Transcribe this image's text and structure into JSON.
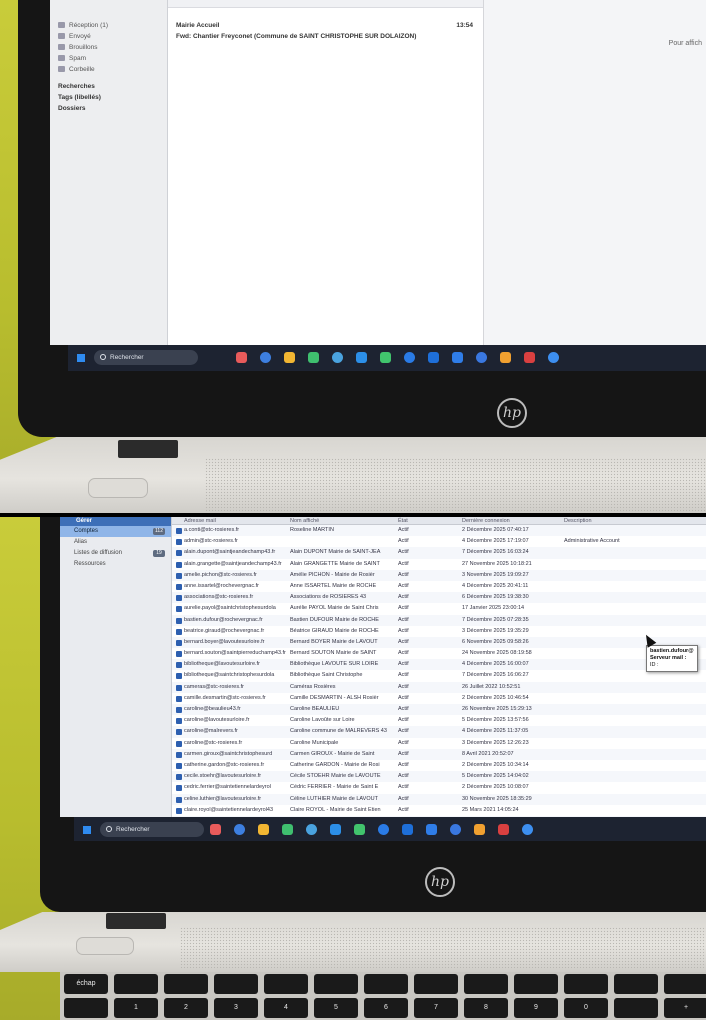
{
  "mail": {
    "folders": [
      {
        "label": "Réception (1)",
        "bold": false
      },
      {
        "label": "Envoyé",
        "bold": false
      },
      {
        "label": "Brouillons",
        "bold": false
      },
      {
        "label": "Spam",
        "bold": false
      },
      {
        "label": "Corbeille",
        "bold": false
      },
      {
        "label": "Recherches",
        "bold": true
      },
      {
        "label": "Tags (libellés)",
        "bold": true
      },
      {
        "label": "Dossiers",
        "bold": true
      }
    ],
    "messages": [
      {
        "text": "Mairie Accueil",
        "time": "13:54"
      },
      {
        "text": "Fwd: Chantier Freyconet (Commune de SAINT CHRISTOPHE SUR DOLAIZON)",
        "time": ""
      }
    ],
    "preview_hint": "Pour affich"
  },
  "taskbar": {
    "search_label": "Rechercher",
    "icon_colors": [
      "#e85b5b",
      "#3d7fe0",
      "#f2b632",
      "#3fbf6f",
      "#4aa3df",
      "#2c8fe8",
      "#41c46d",
      "#2a7be6",
      "#1e6fd9",
      "#2f7de8",
      "#3a78e0",
      "#f0a030",
      "#d94040",
      "#3d8ff0"
    ]
  },
  "admin": {
    "sidebar_header": "Gérer",
    "sidebar": [
      {
        "label": "Comptes",
        "count": "112",
        "selected": true
      },
      {
        "label": "Alias",
        "count": "",
        "selected": false
      },
      {
        "label": "Listes de diffusion",
        "count": "19",
        "selected": false
      },
      {
        "label": "Ressources",
        "count": "",
        "selected": false
      }
    ],
    "columns": [
      "Adresse mail",
      "Nom affiché",
      "État",
      "Dernière connexion",
      "Description"
    ],
    "rows": [
      [
        "a.conti@stc-rosieres.fr",
        "Roseline MARTIN",
        "Actif",
        "2 Décembre 2025 07:40:17",
        ""
      ],
      [
        "admin@stc-rosieres.fr",
        "",
        "Actif",
        "4 Décembre 2025 17:19:07",
        "Administrative Account"
      ],
      [
        "alain.dupont@saintjeandechamp43.fr",
        "Alain DUPONT Mairie de SAINT-JEA",
        "Actif",
        "7 Décembre 2025 16:03:24",
        ""
      ],
      [
        "alain.grangette@saintjeandechamp43.fr",
        "Alain GRANGETTE Mairie de SAINT",
        "Actif",
        "27 Novembre 2025 10:18:21",
        ""
      ],
      [
        "amelie.pichon@stc-rosieres.fr",
        "Amélie PICHON - Mairie de Rosièr",
        "Actif",
        "3 Novembre 2025 19:09:27",
        ""
      ],
      [
        "anne.issartel@rochevergnac.fr",
        "Anne ISSARTEL Mairie de ROCHE",
        "Actif",
        "4 Décembre 2025 20:41:11",
        ""
      ],
      [
        "associations@stc-rosieres.fr",
        "Associations de ROSIERES 43",
        "Actif",
        "6 Décembre 2025 19:38:30",
        ""
      ],
      [
        "aurelie.payol@saintchristophesurdola",
        "Aurélie PAYOL Mairie de Saint Chris",
        "Actif",
        "17 Janvier 2025 23:00:14",
        ""
      ],
      [
        "bastien.dufour@rochevergnac.fr",
        "Bastien DUFOUR Mairie de ROCHE",
        "Actif",
        "7 Décembre 2025 07:28:35",
        ""
      ],
      [
        "beatrice.giraud@rochevergnac.fr",
        "Béatrice GIRAUD Mairie de ROCHE",
        "Actif",
        "3 Décembre 2025 19:35:29",
        ""
      ],
      [
        "bernard.boyer@lavoutesurloire.fr",
        "Bernard BOYER Mairie de LAVOUT",
        "Actif",
        "6 Novembre 2025 09:58:26",
        ""
      ],
      [
        "bernard.souton@saintpierreduchamp43.fr",
        "Bernard SOUTON Mairie de SAINT",
        "Actif",
        "24 Novembre 2025 08:19:58",
        ""
      ],
      [
        "bibliotheque@lavoutesurloire.fr",
        "Bibliothèque LAVOUTE SUR LOIRE",
        "Actif",
        "4 Décembre 2025 16:00:07",
        ""
      ],
      [
        "bibliotheque@saintchristophesurdola",
        "Bibliothèque Saint Christophe",
        "Actif",
        "7 Décembre 2025 16:06:27",
        ""
      ],
      [
        "cameras@stc-rosieres.fr",
        "Caméras Rosières",
        "Actif",
        "26 Juillet 2022 10:52:51",
        ""
      ],
      [
        "camille.desmartin@stc-rosieres.fr",
        "Camille DESMARTIN - ALSH Rosièr",
        "Actif",
        "2 Décembre 2025 10:46:54",
        ""
      ],
      [
        "caroline@beaulieu43.fr",
        "Caroline BEAULIEU",
        "Actif",
        "26 Novembre 2025 15:29:13",
        ""
      ],
      [
        "caroline@lavoutesurloire.fr",
        "Caroline Lavoûte sur Loire",
        "Actif",
        "5 Décembre 2025 13:57:56",
        ""
      ],
      [
        "caroline@malrevers.fr",
        "Caroline commune de MALREVERS 43",
        "Actif",
        "4 Décembre 2025 11:37:05",
        ""
      ],
      [
        "caroline@stc-rosieres.fr",
        "Caroline Municipale",
        "Actif",
        "3 Décembre 2025 12:26:23",
        ""
      ],
      [
        "carmen.giroux@saintchristophesurd",
        "Carmen GIROUX - Mairie de Saint",
        "Actif",
        "8 Avril 2021 20:52:07",
        ""
      ],
      [
        "catherine.gardon@stc-rosieres.fr",
        "Catherine GARDON - Mairie de Rosi",
        "Actif",
        "2 Décembre 2025 10:34:14",
        ""
      ],
      [
        "cecile.stoehr@lavoutesurloire.fr",
        "Cécile STOEHR Mairie de LAVOUTE",
        "Actif",
        "5 Décembre 2025 14:04:02",
        ""
      ],
      [
        "cedric.ferrier@saintetiennelardeyrol",
        "Cédric FERRIER - Mairie de Saint E",
        "Actif",
        "2 Décembre 2025 10:08:07",
        ""
      ],
      [
        "celine.luthier@lavoutesurloire.fr",
        "Céline LUTHIER Mairie de LAVOUT",
        "Actif",
        "30 Novembre 2025 18:35:29",
        ""
      ],
      [
        "claire.royol@saintetiennelardeyrol43",
        "Claire ROYOL - Mairie de Saint Etien",
        "Actif",
        "25 Mars 2021 14:05:24",
        ""
      ],
      [
        "claire.gallien@saintpierreduchamp43",
        "Claire GALLIEN Mairie de SAINT PI",
        "Actif",
        "2 Janvier 2024 09:19:53",
        ""
      ]
    ],
    "popup": {
      "line1": "bastien.dufour@",
      "line2": "Serveur mail : ",
      "line3": "ID : "
    }
  },
  "brand": {
    "logo_text": "hp"
  },
  "keyboard": {
    "fn_row": [
      "échap",
      "",
      "",
      "",
      "",
      "",
      "",
      "",
      "",
      "",
      "",
      "",
      ""
    ],
    "num_row": [
      "",
      "1",
      "2",
      "3",
      "4",
      "5",
      "6",
      "7",
      "8",
      "9",
      "0",
      "",
      "+"
    ]
  }
}
